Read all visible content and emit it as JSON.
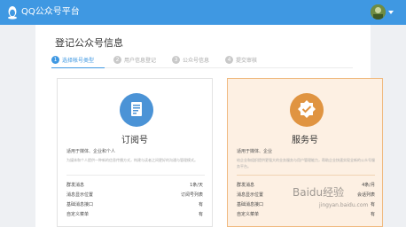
{
  "header": {
    "app_title": "QQ公众号平台",
    "logo_icon": "qq-penguin-icon",
    "avatar_icon": "user-avatar"
  },
  "page": {
    "title": "登记公众号信息"
  },
  "steps": [
    {
      "num": "1",
      "label": "选择帐号类型",
      "active": true
    },
    {
      "num": "2",
      "label": "用户信息登记",
      "active": false
    },
    {
      "num": "3",
      "label": "公众号信息",
      "active": false
    },
    {
      "num": "4",
      "label": "提交审核",
      "active": false
    }
  ],
  "cards": {
    "subscription": {
      "name": "订阅号",
      "icon": "document-icon",
      "fit": "适用于媒体、企业和个人",
      "desc": "为媒体和个人提供一种新的信息传播方式，构建与读者之间更好的沟通与管理模式。",
      "rows": [
        {
          "k": "群发消息",
          "v": "1条/天"
        },
        {
          "k": "消息显示位置",
          "v": "订阅号列表"
        },
        {
          "k": "基础消息接口",
          "v": "有"
        },
        {
          "k": "自定义菜单",
          "v": "有"
        }
      ]
    },
    "service": {
      "name": "服务号",
      "icon": "verified-badge-icon",
      "fit": "适用于媒体、企业",
      "desc": "给企业和组织提供更强大的业务服务与用户管理能力，帮助企业快速实现全新的公众号服务平台。",
      "rows": [
        {
          "k": "群发消息",
          "v": "4条/月"
        },
        {
          "k": "消息显示位置",
          "v": "会话列表"
        },
        {
          "k": "基础消息接口",
          "v": "有"
        },
        {
          "k": "自定义菜单",
          "v": "有"
        }
      ]
    }
  },
  "colors": {
    "primary": "#3f98e2",
    "accent_orange": "#e09441",
    "card_highlight_bg": "#fdf0e3"
  },
  "watermark": {
    "main": "Baidu经验",
    "sub": "jingyan.baidu.com"
  }
}
